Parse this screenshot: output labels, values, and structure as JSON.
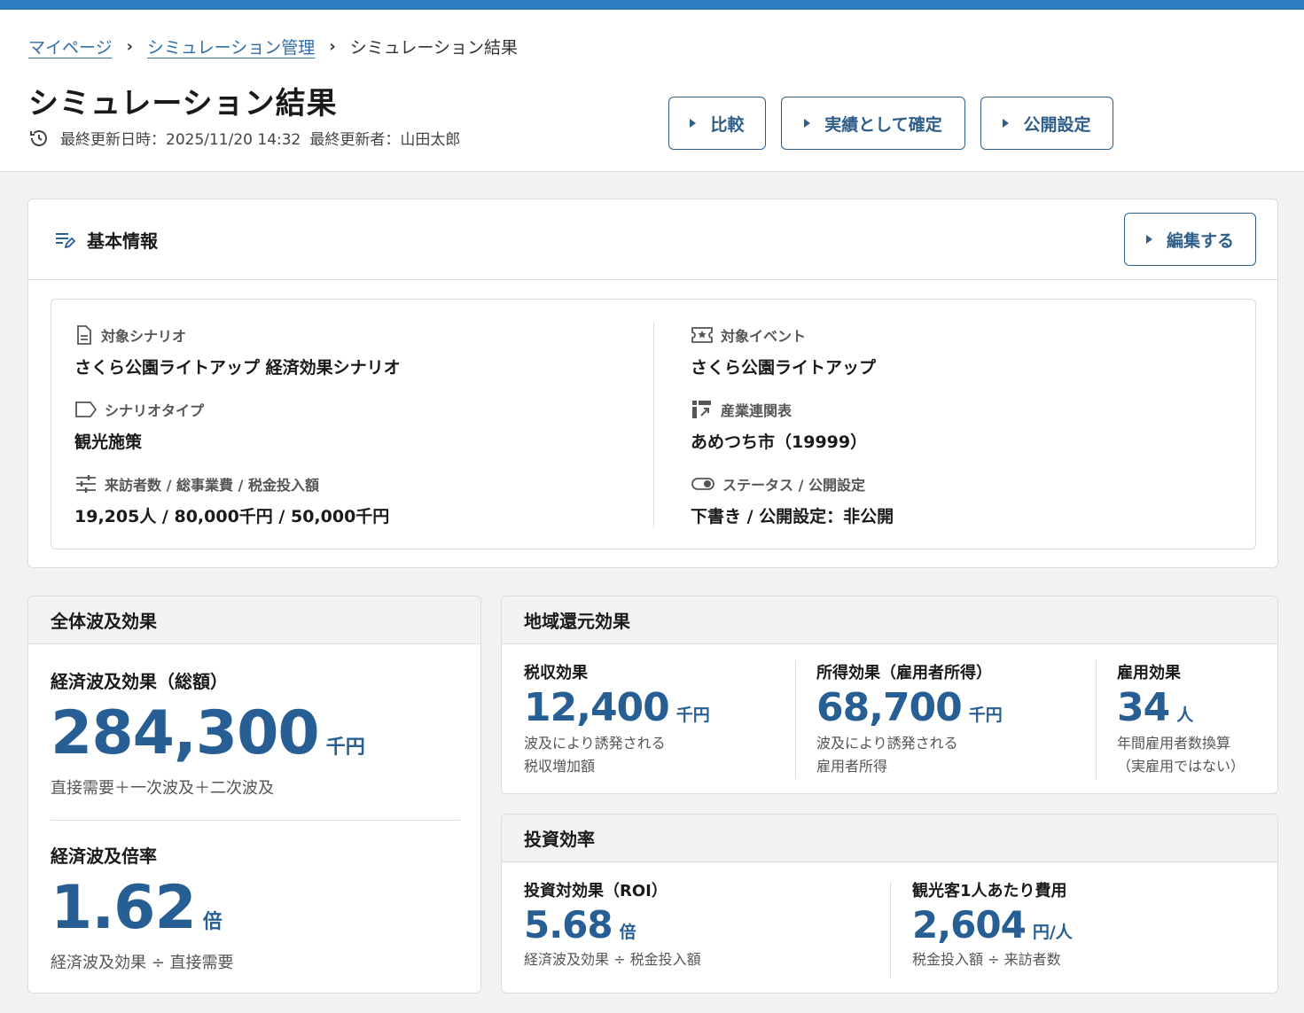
{
  "breadcrumb": {
    "items": [
      "マイページ",
      "シミュレーション管理"
    ],
    "current": "シミュレーション結果"
  },
  "page": {
    "title": "シミュレーション結果",
    "last_updated": "最終更新日時：2025/11/20 14:32",
    "last_updated_by": "最終更新者：山田太郎"
  },
  "actions": {
    "compare": "比較",
    "confirm": "実績として確定",
    "publish": "公開設定"
  },
  "basic_info": {
    "title": "基本情報",
    "edit_label": "編集する",
    "scenario_label": "対象シナリオ",
    "scenario_value": "さくら公園ライトアップ 経済効果シナリオ",
    "type_label": "シナリオタイプ",
    "type_value": "観光施策",
    "figures_label": "来訪者数 / 総事業費 / 税金投入額",
    "figures_value": "19,205人 / 80,000千円 / 50,000千円",
    "event_label": "対象イベント",
    "event_value": "さくら公園ライトアップ",
    "io_table_label": "産業連関表",
    "io_table_value": "あめつち市（19999）",
    "status_label": "ステータス / 公開設定",
    "status_value": "下書き / 公開設定：非公開"
  },
  "overall": {
    "title": "全体波及効果",
    "total_label": "経済波及効果（総額）",
    "total_value": "284,300",
    "total_unit": "千円",
    "total_note": "直接需要＋一次波及＋二次波及",
    "ratio_label": "経済波及倍率",
    "ratio_value": "1.62",
    "ratio_unit": "倍",
    "ratio_note": "経済波及効果 ÷ 直接需要"
  },
  "regional": {
    "title": "地域還元効果",
    "tax_label": "税収効果",
    "tax_value": "12,400",
    "tax_unit": "千円",
    "tax_note1": "波及により誘発される",
    "tax_note2": "税収増加額",
    "income_label": "所得効果（雇用者所得）",
    "income_value": "68,700",
    "income_unit": "千円",
    "income_note1": "波及により誘発される",
    "income_note2": "雇用者所得",
    "employ_label": "雇用効果",
    "employ_value": "34",
    "employ_unit": "人",
    "employ_note1": "年間雇用者数換算",
    "employ_note2": "（実雇用ではない）"
  },
  "investment": {
    "title": "投資効率",
    "roi_label": "投資対効果（ROI）",
    "roi_value": "5.68",
    "roi_unit": "倍",
    "roi_note": "経済波及効果 ÷ 税金投入額",
    "cost_label": "観光客1人あたり費用",
    "cost_value": "2,604",
    "cost_unit": "円/人",
    "cost_note": "税金投入額 ÷ 来訪者数"
  },
  "colors": {
    "accent": "#2f7bbf",
    "number": "#275f95",
    "button_border": "#2e5f8a"
  }
}
